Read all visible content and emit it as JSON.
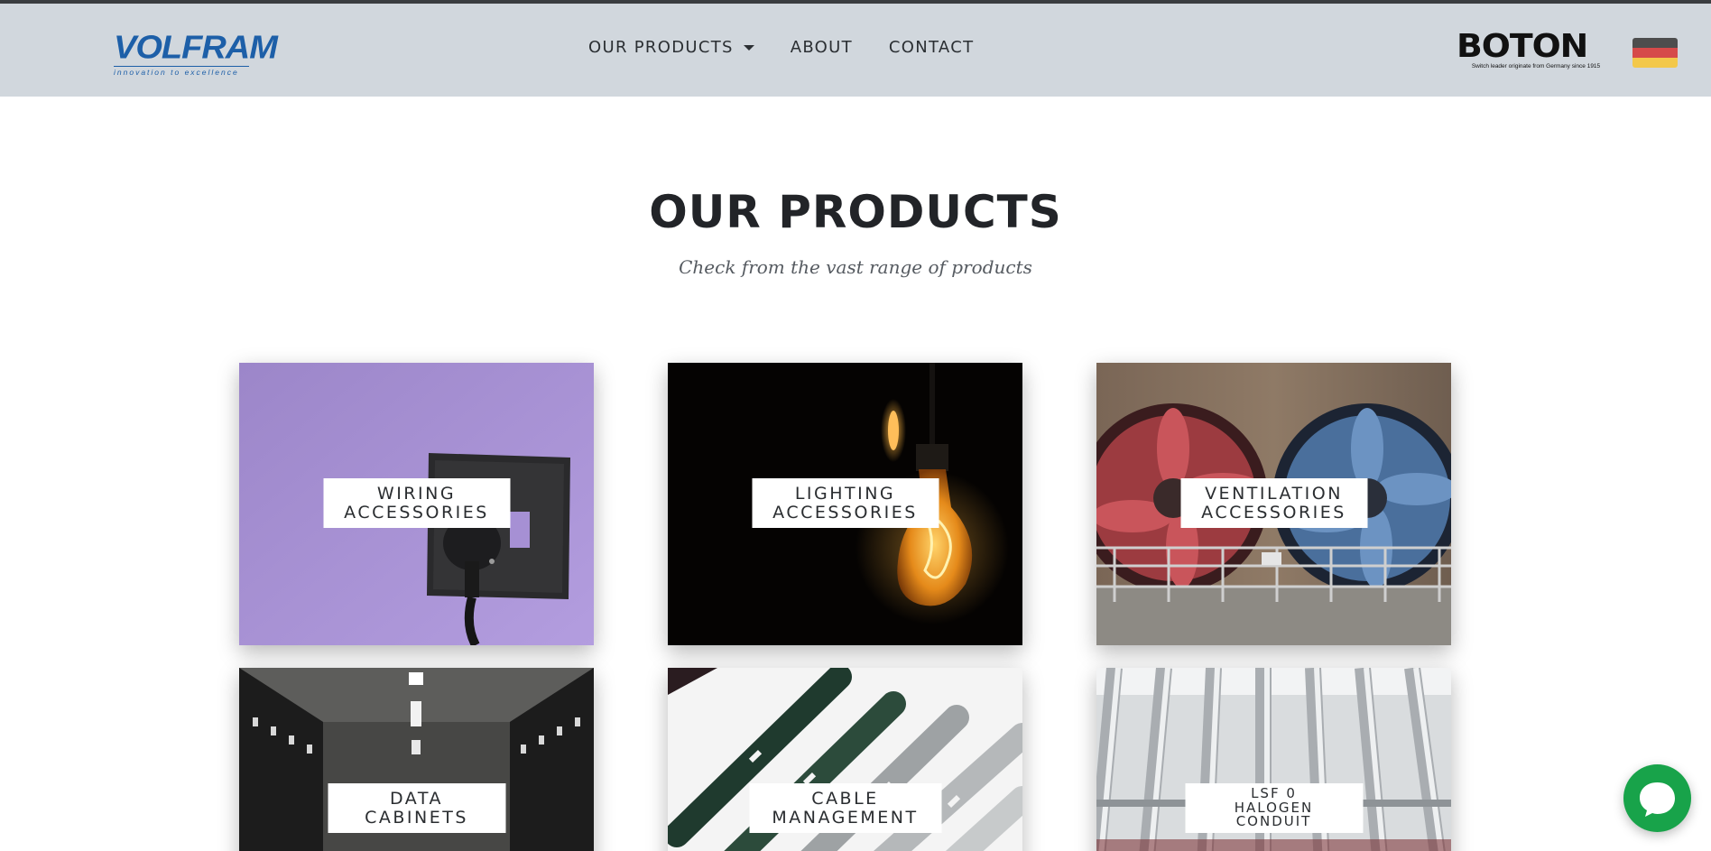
{
  "header": {
    "logo_brand": "VOLFRAM",
    "logo_tagline": "innovation to excellence",
    "nav": [
      {
        "label": "OUR PRODUCTS",
        "has_dropdown": true
      },
      {
        "label": "ABOUT"
      },
      {
        "label": "CONTACT"
      }
    ],
    "partner_brand": "BOTON",
    "partner_tagline": "Switch leader originate from Germany since 1915",
    "language_flag": "germany-flag-icon"
  },
  "section": {
    "title": "OUR PRODUCTS",
    "subtitle": "Check from the vast range of products"
  },
  "products": [
    {
      "label_line1": "WIRING",
      "label_line2": "ACCESSORIES",
      "image": "wall-socket-plug-image"
    },
    {
      "label_line1": "LIGHTING",
      "label_line2": "ACCESSORIES",
      "image": "light-bulb-image"
    },
    {
      "label_line1": "VENTILATION",
      "label_line2": "ACCESSORIES",
      "image": "industrial-fans-image"
    },
    {
      "label_line1": "DATA",
      "label_line2": "CABINETS",
      "image": "server-room-image"
    },
    {
      "label_line1": "CABLE",
      "label_line2": "MANAGEMENT",
      "image": "metal-channels-image"
    },
    {
      "label_line1": "LSF 0",
      "label_line2": "HALOGEN",
      "label_line3": "CONDUIT",
      "image": "conduit-pipes-image"
    }
  ],
  "chat": {
    "icon": "chat-bubble-icon"
  },
  "colors": {
    "header_bg": "#d1d7dd",
    "logo_blue": "#1d5fa8",
    "chat_green": "#18a34a"
  }
}
